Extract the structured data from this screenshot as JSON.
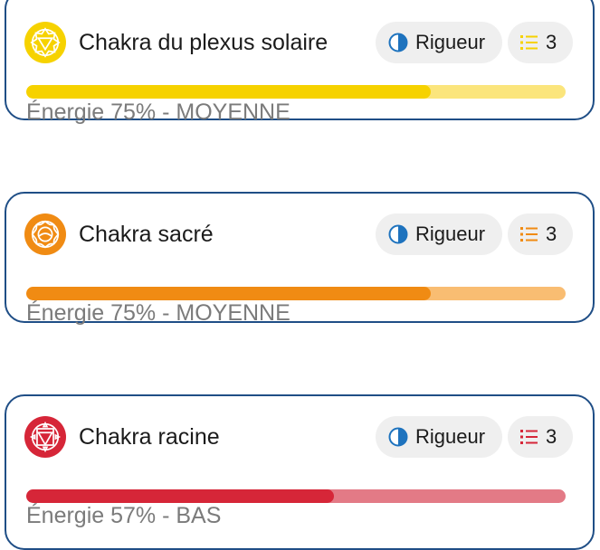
{
  "cards": [
    {
      "title": "Chakra du plexus solaire",
      "icon": "solar-plexus-chakra-icon",
      "rigor_icon": "half-circle-icon",
      "rigor_label": "Rigueur",
      "count_icon": "list-icon",
      "count": "3",
      "energy_percent": 75,
      "status": "Énergie 75% - MOYENNE",
      "colors": {
        "main": "#f6d200",
        "light": "#fbe57c"
      }
    },
    {
      "title": "Chakra sacré",
      "icon": "sacral-chakra-icon",
      "rigor_icon": "half-circle-icon",
      "rigor_label": "Rigueur",
      "count_icon": "list-icon",
      "count": "3",
      "energy_percent": 75,
      "status": "Énergie 75% - MOYENNE",
      "colors": {
        "main": "#f08b13",
        "light": "#f9bd72"
      }
    },
    {
      "title": "Chakra racine",
      "icon": "root-chakra-icon",
      "rigor_icon": "half-circle-icon",
      "rigor_label": "Rigueur",
      "count_icon": "list-icon",
      "count": "3",
      "energy_percent": 57,
      "status": "Énergie 57% - BAS",
      "colors": {
        "main": "#d62638",
        "light": "#e37a86"
      }
    }
  ],
  "colors": {
    "border": "#1f4e86",
    "rigor_icon": "#1e73be",
    "pill_bg": "#efefef",
    "status_text": "#7b7b7b"
  }
}
